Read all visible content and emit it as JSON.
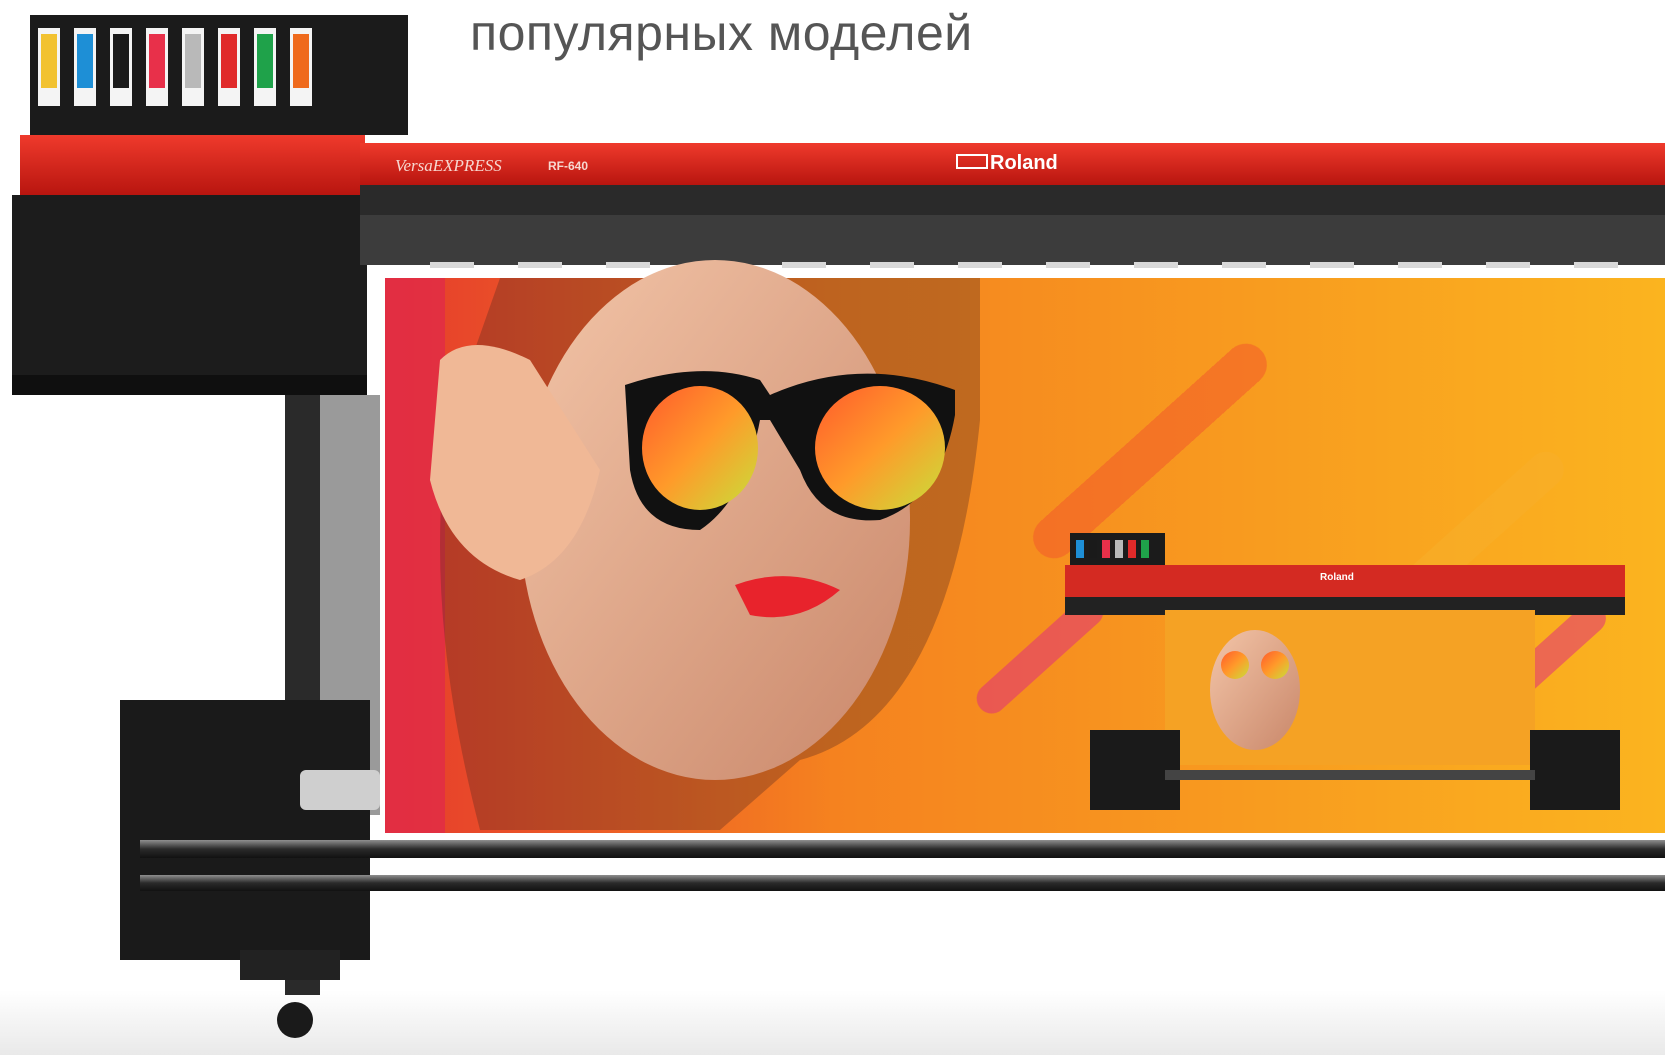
{
  "page": {
    "heading": "популярных моделей"
  },
  "printer": {
    "series_label": "VersaEXPRESS",
    "model_label": "RF-640",
    "brand_label": "Roland",
    "ink_colors": [
      "#f2c230",
      "#1e8fd6",
      "#1a1a1a",
      "#e8304a",
      "#b9b9b9",
      "#e02a2a",
      "#1fa24a",
      "#ef6a1c"
    ],
    "body_color": "#e1231b",
    "frame_color": "#1a1a1a"
  },
  "banner": {
    "gradient": [
      "#e53b2c",
      "#f5821f",
      "#fbb41f"
    ],
    "inset_brand_label": "Roland"
  }
}
